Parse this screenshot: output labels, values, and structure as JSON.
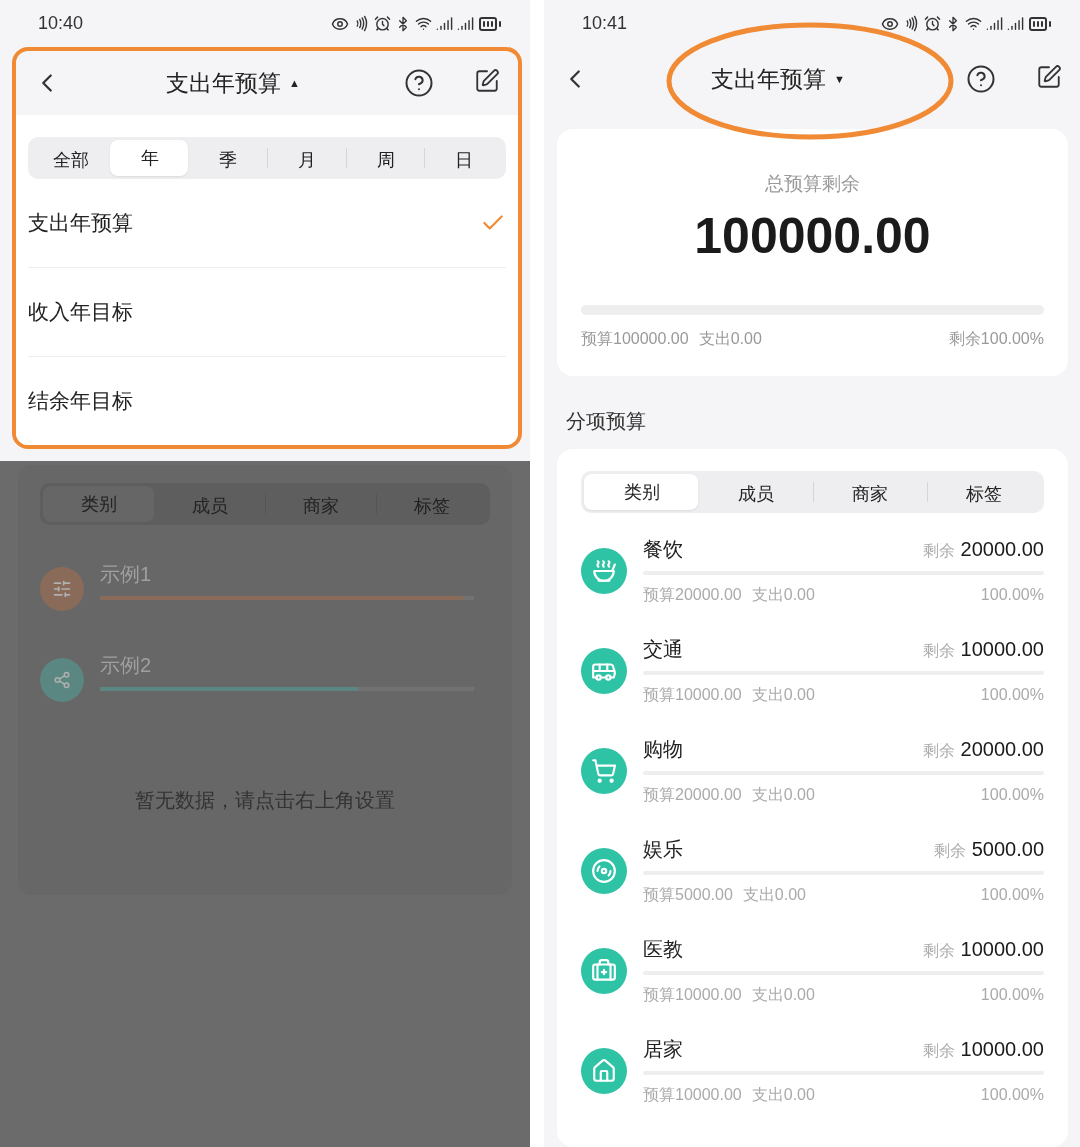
{
  "left_screen": {
    "status_bar": {
      "time": "10:40"
    },
    "nav": {
      "title": "支出年预算",
      "caret": "▲"
    },
    "period_tabs": [
      {
        "label": "全部",
        "selected": false
      },
      {
        "label": "年",
        "selected": true
      },
      {
        "label": "季",
        "selected": false
      },
      {
        "label": "月",
        "selected": false
      },
      {
        "label": "周",
        "selected": false
      },
      {
        "label": "日",
        "selected": false
      }
    ],
    "options": [
      {
        "label": "支出年预算",
        "checked": true
      },
      {
        "label": "收入年目标",
        "checked": false
      },
      {
        "label": "结余年目标",
        "checked": false
      }
    ],
    "backdrop": {
      "tabs": [
        {
          "label": "类别",
          "selected": true
        },
        {
          "label": "成员",
          "selected": false
        },
        {
          "label": "商家",
          "selected": false
        },
        {
          "label": "标签",
          "selected": false
        }
      ],
      "items": [
        {
          "name": "示例1",
          "color": "#8a6b5a",
          "level": 0.97
        },
        {
          "name": "示例2",
          "color": "#5a8782",
          "level": 0.69
        }
      ],
      "empty_message": "暂无数据，请点击右上角设置"
    }
  },
  "right_screen": {
    "status_bar": {
      "time": "10:41"
    },
    "nav": {
      "title": "支出年预算",
      "caret": "▼"
    },
    "summary": {
      "label": "总预算剩余",
      "amount": "100000.00",
      "budget": "预算100000.00",
      "spent": "支出0.00",
      "remaining": "剩余100.00%"
    },
    "section_title": "分项预算",
    "tabs": [
      {
        "label": "类别",
        "selected": true
      },
      {
        "label": "成员",
        "selected": false
      },
      {
        "label": "商家",
        "selected": false
      },
      {
        "label": "标签",
        "selected": false
      }
    ],
    "categories": [
      {
        "kind": "food",
        "name": "餐饮",
        "remaining_label": "剩余",
        "remaining": "20000.00",
        "budget": "预算20000.00",
        "spent": "支出0.00",
        "percent": "100.00%"
      },
      {
        "kind": "transport",
        "name": "交通",
        "remaining_label": "剩余",
        "remaining": "10000.00",
        "budget": "预算10000.00",
        "spent": "支出0.00",
        "percent": "100.00%"
      },
      {
        "kind": "shopping",
        "name": "购物",
        "remaining_label": "剩余",
        "remaining": "20000.00",
        "budget": "预算20000.00",
        "spent": "支出0.00",
        "percent": "100.00%"
      },
      {
        "kind": "entertainment",
        "name": "娱乐",
        "remaining_label": "剩余",
        "remaining": "5000.00",
        "budget": "预算5000.00",
        "spent": "支出0.00",
        "percent": "100.00%"
      },
      {
        "kind": "medical",
        "name": "医教",
        "remaining_label": "剩余",
        "remaining": "10000.00",
        "budget": "预算10000.00",
        "spent": "支出0.00",
        "percent": "100.00%"
      },
      {
        "kind": "home",
        "name": "居家",
        "remaining_label": "剩余",
        "remaining": "10000.00",
        "budget": "预算10000.00",
        "spent": "支出0.00",
        "percent": "100.00%"
      }
    ]
  }
}
